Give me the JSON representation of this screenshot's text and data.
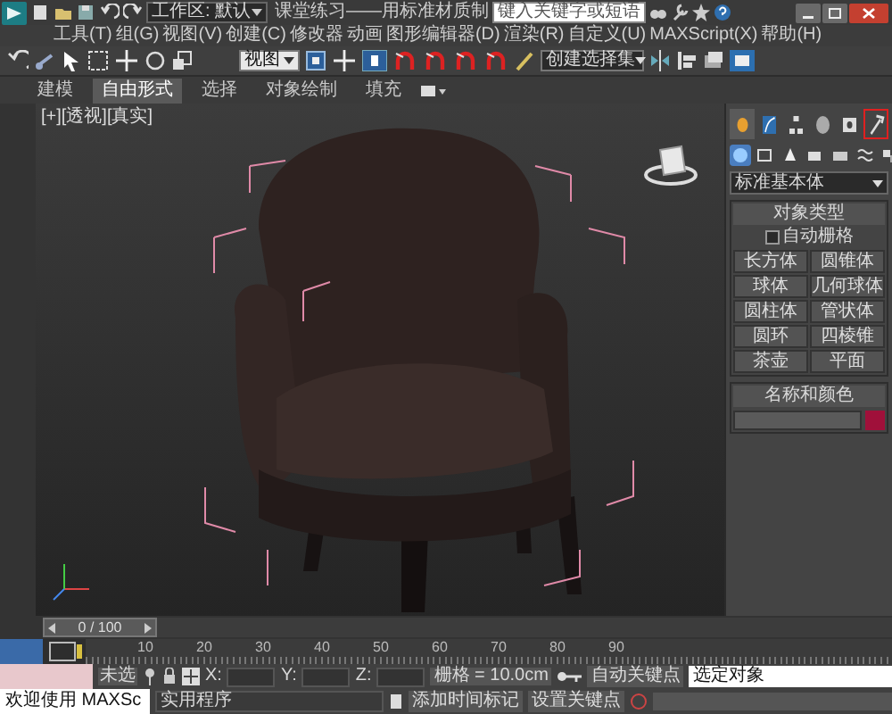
{
  "title_bar": {
    "workspace": "工作区: 默认",
    "title": "课堂练习——用标准材质制",
    "search_placeholder": "键入关键字或短语"
  },
  "menu": [
    "工具(T)",
    "组(G)",
    "视图(V)",
    "创建(C)",
    "修改器",
    "动画",
    "图形编辑器(D)",
    "渲染(R)",
    "自定义(U)",
    "MAXScript(X)",
    "帮助(H)"
  ],
  "toolbar": {
    "view_dropdown": "视图",
    "selection_set": "创建选择集"
  },
  "ribbon_tabs": [
    {
      "label": "建模",
      "selected": false
    },
    {
      "label": "自由形式",
      "selected": true
    },
    {
      "label": "选择",
      "selected": false
    },
    {
      "label": "对象绘制",
      "selected": false
    },
    {
      "label": "填充",
      "selected": false
    }
  ],
  "viewport": {
    "label": "[+][透视][真实]"
  },
  "command_panel": {
    "tabs": [
      {
        "kind": "create",
        "selected": true,
        "highlighted": false
      },
      {
        "kind": "modify",
        "selected": false,
        "highlighted": false
      },
      {
        "kind": "hierarchy",
        "selected": false,
        "highlighted": false
      },
      {
        "kind": "motion",
        "selected": false,
        "highlighted": false
      },
      {
        "kind": "display",
        "selected": false,
        "highlighted": false
      },
      {
        "kind": "utilities",
        "selected": false,
        "highlighted": true
      }
    ],
    "categories": [
      {
        "kind": "geometry",
        "selected": true
      },
      {
        "kind": "shapes",
        "selected": false
      },
      {
        "kind": "lights",
        "selected": false
      },
      {
        "kind": "cameras",
        "selected": false
      },
      {
        "kind": "helpers",
        "selected": false
      },
      {
        "kind": "spacewarps",
        "selected": false
      },
      {
        "kind": "systems",
        "selected": false
      }
    ],
    "category_dropdown": "标准基本体",
    "object_type": {
      "title": "对象类型",
      "autogrid": {
        "label": "自动栅格",
        "checked": false
      },
      "buttons": [
        "长方体",
        "圆锥体",
        "球体",
        "几何球体",
        "圆柱体",
        "管状体",
        "圆环",
        "四棱锥",
        "茶壶",
        "平面"
      ]
    },
    "name_color": {
      "title": "名称和颜色",
      "color": "#a0103a"
    }
  },
  "timeline": {
    "position": "0 / 100",
    "level": 0,
    "ticks": [
      "10",
      "20",
      "30",
      "40",
      "50",
      "60",
      "70",
      "80",
      "90"
    ]
  },
  "status": {
    "selection": "未选",
    "x": "X:",
    "y": "Y:",
    "z": "Z:",
    "grid": "栅格 = 10.0cm",
    "auto_key": "自动关键点",
    "key_mode": "选定对象",
    "welcome": "欢迎使用 MAXSc",
    "script_line": "实用程序",
    "add_time_tag": "添加时间标记",
    "set_key": "设置关键点"
  }
}
